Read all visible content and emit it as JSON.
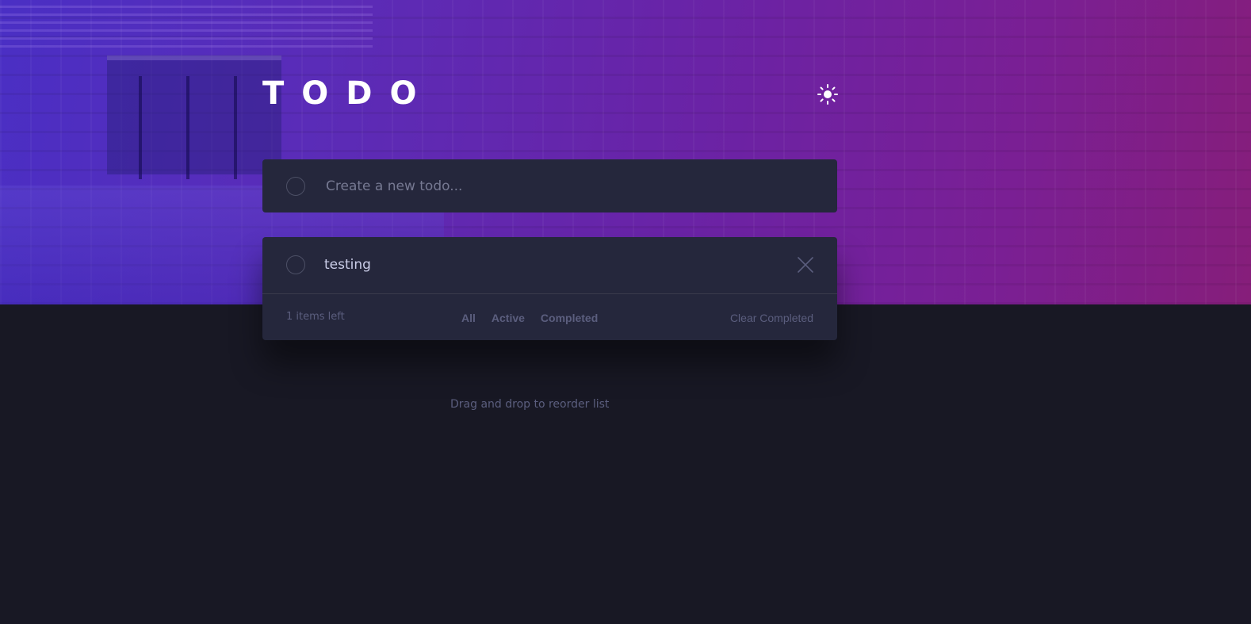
{
  "header": {
    "title": "TODO",
    "theme_toggle_icon": "sun-icon"
  },
  "new_todo": {
    "placeholder": "Create a new todo...",
    "value": ""
  },
  "todos": [
    {
      "text": "testing",
      "completed": false
    }
  ],
  "footer": {
    "items_left": "1 items left",
    "filters": [
      "All",
      "Active",
      "Completed"
    ],
    "clear_label": "Clear Completed"
  },
  "hint": "Drag and drop to reorder list",
  "colors": {
    "background": "#181824",
    "card": "#25273c",
    "text": "#cacde8",
    "muted": "#5b5e7e",
    "gradient_start": "#4a2fc4",
    "gradient_end": "#861e7a"
  }
}
